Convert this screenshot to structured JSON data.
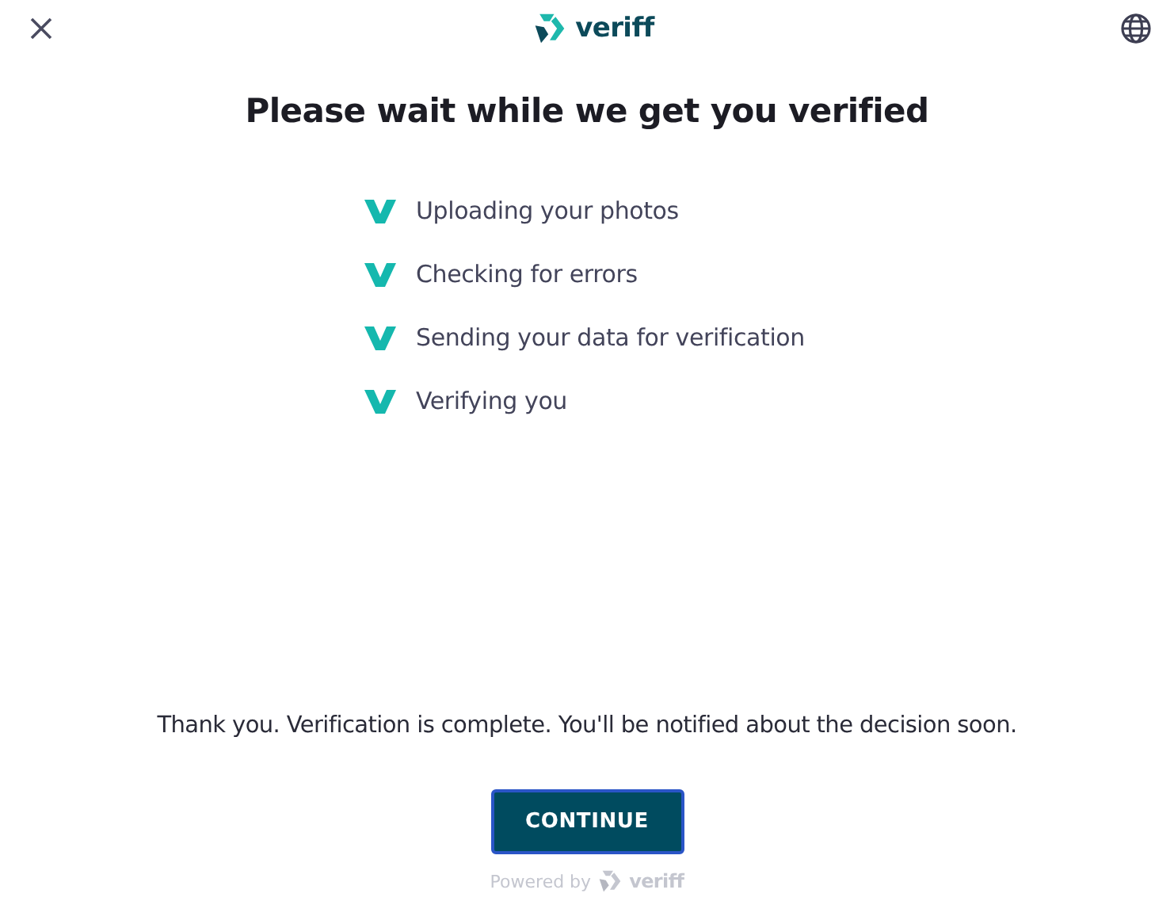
{
  "header": {
    "brand": "veriff"
  },
  "title": "Please wait while we get you verified",
  "steps": [
    {
      "label": "Uploading your photos",
      "done": true
    },
    {
      "label": "Checking for errors",
      "done": true
    },
    {
      "label": "Sending your data for verification",
      "done": true
    },
    {
      "label": "Verifying you",
      "done": true
    }
  ],
  "message": "Thank you. Verification is complete. You'll be notified about the decision soon.",
  "button": "CONTINUE",
  "footer": {
    "powered_by": "Powered by",
    "brand": "veriff"
  }
}
